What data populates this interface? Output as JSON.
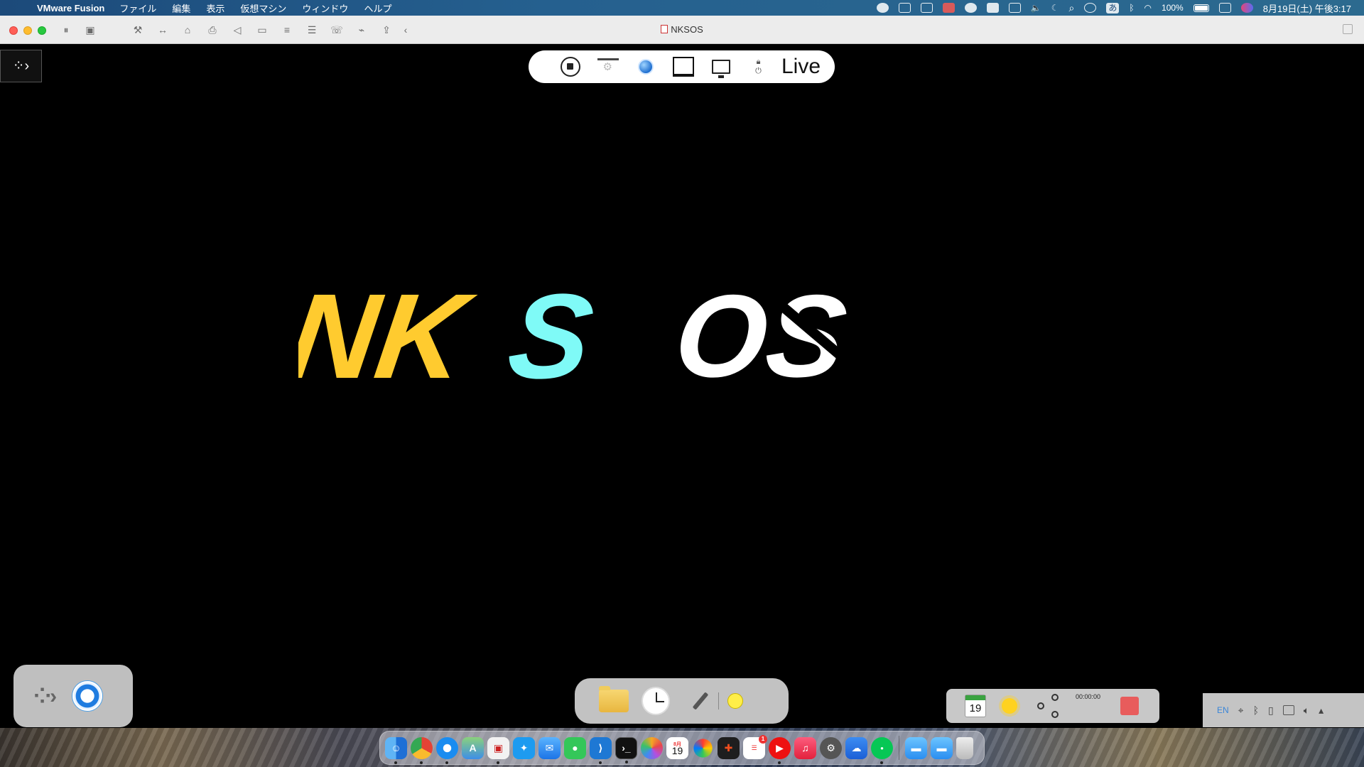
{
  "menubar": {
    "app_name": "VMware Fusion",
    "menus": [
      "ファイル",
      "編集",
      "表示",
      "仮想マシン",
      "ウィンドウ",
      "ヘルプ"
    ],
    "battery_percent": "100%",
    "ime_label": "あ",
    "clock": "8月19日(土) 午後3:17"
  },
  "window": {
    "title": "NKSOS"
  },
  "vm_toolbar": {
    "live_label": "Live"
  },
  "logo": {
    "part1": "NK",
    "part2": "S",
    "part3": "OS",
    "colors": {
      "nk": "#ffcb2f",
      "s": "#7ffaf7",
      "os": "#ffffff"
    }
  },
  "widgets": {
    "calendar_day": "19",
    "timer": "00:00:00"
  },
  "systray": {
    "lang": "EN"
  },
  "mac_dock": {
    "calendar_day": "19",
    "calendar_month": "8月",
    "reminders_badge": "1"
  }
}
